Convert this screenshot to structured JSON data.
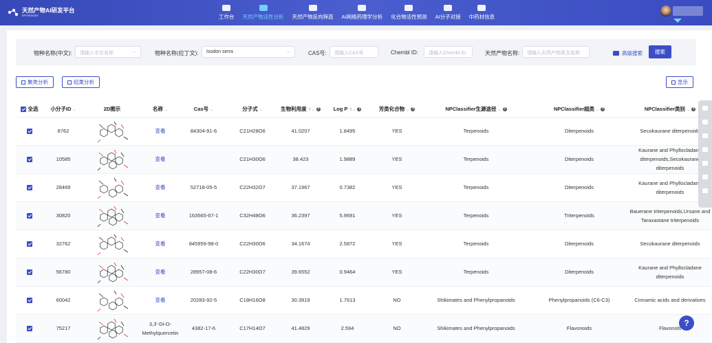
{
  "header": {
    "logo_title": "天然产物AI研发平台",
    "logo_sub": "NPAIMaster",
    "nav": [
      {
        "label": "工作台",
        "active": false
      },
      {
        "label": "天然产物活性分析",
        "active": true
      },
      {
        "label": "天然产物反向筛选",
        "active": false
      },
      {
        "label": "AI网络药理学分析",
        "active": false
      },
      {
        "label": "化合物活性预测",
        "active": false
      },
      {
        "label": "AI分子对接",
        "active": false
      },
      {
        "label": "中药材信息",
        "active": false
      }
    ]
  },
  "filter": {
    "cn_label": "物种名称(中文):",
    "cn_placeholder": "请输入中文名称",
    "latin_label": "物种名称(拉丁文):",
    "latin_value": "Isodon serra",
    "cas_label": "CAS号:",
    "cas_placeholder": "请输入CAS号",
    "chembl_label": "Chembl ID:",
    "chembl_placeholder": "请输入Chembl ID",
    "np_label": "天然产物名称:",
    "np_placeholder": "请输入天然产物英文名称",
    "advanced": "高级搜索",
    "search": "搜索"
  },
  "actions": {
    "cluster": "聚类分析",
    "result": "结果分析",
    "display": "显示"
  },
  "table": {
    "headers": {
      "select_all": "全选",
      "id": "小分子ID",
      "img": "2D图示",
      "name": "名称",
      "cas": "Cas号",
      "formula": "分子式",
      "bio": "生物利用度",
      "logp": "Log P",
      "aromatic": "芳类化合物",
      "path": "NPClassifier生源途径",
      "superclass": "NPClassifier超类",
      "class": "NPClassifier类别"
    },
    "rows": [
      {
        "id": "8762",
        "name": "查看",
        "cas": "84304-91-6",
        "formula": "C21H28O6",
        "bio": "41.0207",
        "logp": "1.8495",
        "aromatic": "YES",
        "path": "Terpenoids",
        "superclass": "Diterpenoids",
        "class": "Secokaurane diterpenoids"
      },
      {
        "id": "10585",
        "name": "查看",
        "cas": "",
        "formula": "C21H30O6",
        "bio": "38.423",
        "logp": "1.9889",
        "aromatic": "YES",
        "path": "Terpenoids",
        "superclass": "Diterpenoids",
        "class": "Kaurane and Phyllocladane diterpenoids,Secokaurane diterpenoids"
      },
      {
        "id": "28469",
        "name": "查看",
        "cas": "52718-05-5",
        "formula": "C22H32O7",
        "bio": "37.1967",
        "logp": "0.7382",
        "aromatic": "YES",
        "path": "Terpenoids",
        "superclass": "Diterpenoids",
        "class": "Kaurane and Phyllocladane diterpenoids"
      },
      {
        "id": "30820",
        "name": "查看",
        "cas": "163565-67-1",
        "formula": "C32H48O6",
        "bio": "36.2397",
        "logp": "5.9691",
        "aromatic": "YES",
        "path": "Terpenoids",
        "superclass": "Triterpenoids",
        "class": "Bauerane triterpenoids,Ursane and Taraxastane triterpenoids"
      },
      {
        "id": "32762",
        "name": "查看",
        "cas": "845959-98-0",
        "formula": "C22H30O6",
        "bio": "34.1674",
        "logp": "2.5872",
        "aromatic": "YES",
        "path": "Terpenoids",
        "superclass": "Diterpenoids",
        "class": "Secokaurane diterpenoids"
      },
      {
        "id": "56780",
        "name": "查看",
        "cas": "28957-08-6",
        "formula": "C22H30O7",
        "bio": "39.6552",
        "logp": "0.9464",
        "aromatic": "YES",
        "path": "Terpenoids",
        "superclass": "Diterpenoids",
        "class": "Kaurane and Phyllocladane diterpenoids"
      },
      {
        "id": "60042",
        "name": "查看",
        "cas": "20283-92-5",
        "formula": "C18H16O8",
        "bio": "30.3919",
        "logp": "1.7613",
        "aromatic": "NO",
        "path": "Shikimates and Phenylpropanoids",
        "superclass": "Phenylpropanoids (C6-C3)",
        "class": "Cinnamic acids and derivatives"
      },
      {
        "id": "75217",
        "name": "3,3'-Di-O-Methylquercetin",
        "cas": "4382-17-6",
        "formula": "C17H14O7",
        "bio": "41.4829",
        "logp": "2.594",
        "aromatic": "NO",
        "path": "Shikimates and Phenylpropanoids",
        "superclass": "Flavonoids",
        "class": "Flavonols"
      }
    ]
  },
  "help": "?"
}
